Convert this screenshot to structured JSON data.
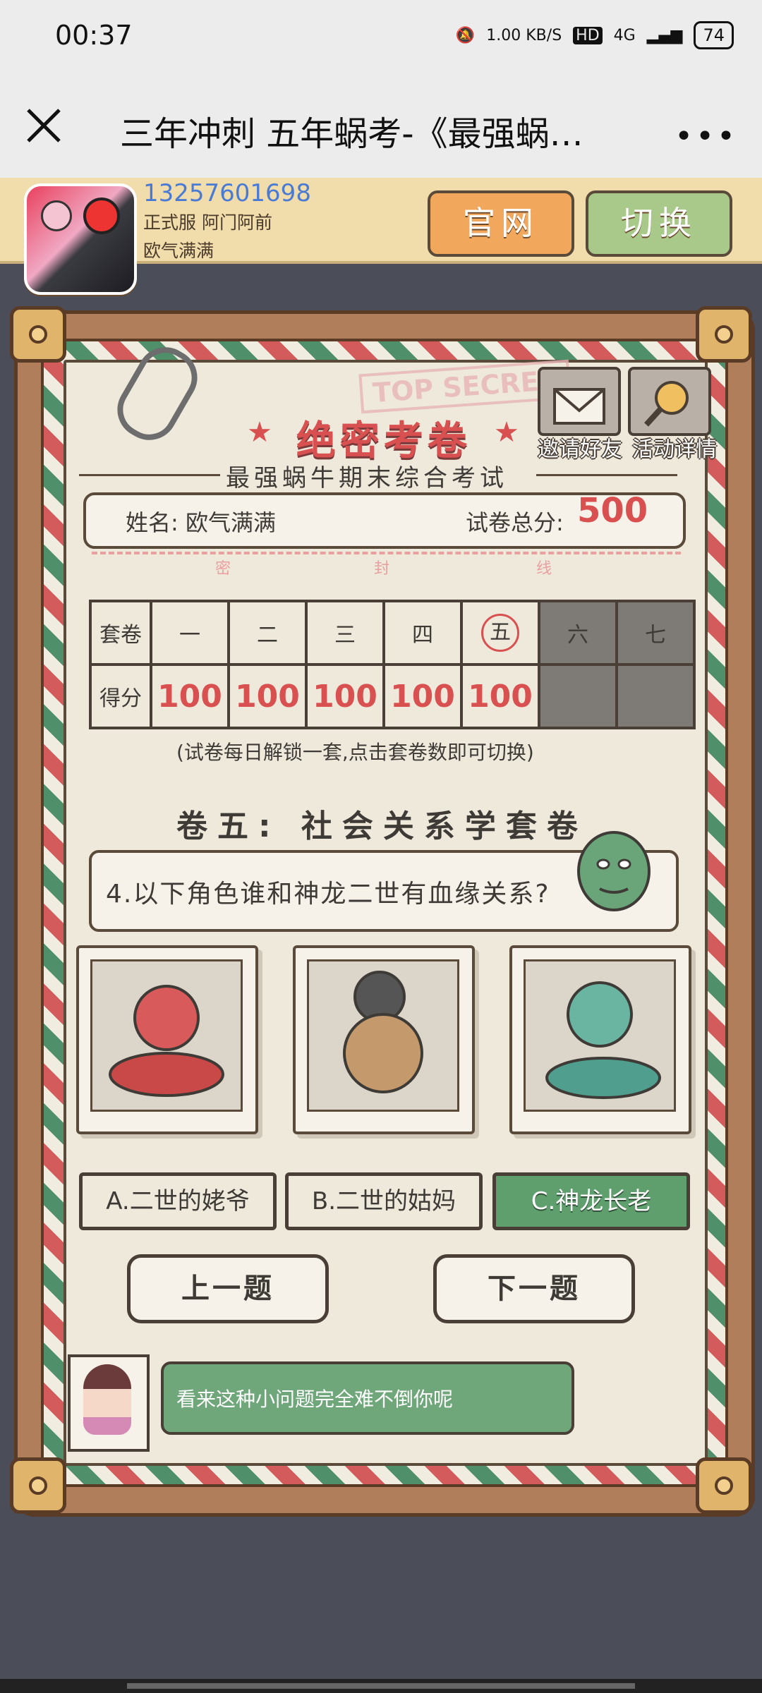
{
  "status_bar": {
    "time": "00:37",
    "net_speed": "1.00 KB/S",
    "hd": "HD",
    "signal": "4G",
    "battery": "74"
  },
  "title_bar": {
    "title": "三年冲刺 五年蜗考-《最强蜗…",
    "more": "•••"
  },
  "user": {
    "phone": "13257601698",
    "server": "正式服 阿门阿前",
    "nickname": "欧气满满"
  },
  "header_buttons": {
    "official": "官网",
    "switch": "切换"
  },
  "paper": {
    "stamp": "TOP SECRET",
    "title": "绝密考卷",
    "subtitle": "最强蜗牛期末综合考试",
    "invite": "邀请好友",
    "activity": "活动详情",
    "name_label": "姓名: 欧气满满",
    "score_label": "试卷总分:",
    "total_score": "500",
    "seal": [
      "密",
      "封",
      "线"
    ]
  },
  "score_table": {
    "set_header": "套卷",
    "score_header": "得分",
    "sets": [
      "一",
      "二",
      "三",
      "四",
      "五",
      "六",
      "七"
    ],
    "scores": [
      "100",
      "100",
      "100",
      "100",
      "100",
      "",
      ""
    ],
    "current_set_index": 4,
    "hint": "(试卷每日解锁一套,点击套卷数即可切换)"
  },
  "question": {
    "set_title": "卷五: 社会关系学套卷",
    "text": "4.以下角色谁和神龙二世有血缘关系?"
  },
  "options": [
    {
      "label": "A.二世的姥爷",
      "selected": false
    },
    {
      "label": "B.二世的姑妈",
      "selected": false
    },
    {
      "label": "C.神龙长老",
      "selected": true
    }
  ],
  "nav": {
    "prev": "上一题",
    "next": "下一题"
  },
  "tip": "看来这种小问题完全难不倒你呢",
  "colors": {
    "accent_red": "#d95050",
    "selected_green": "#5f9f6e",
    "official_btn": "#f2a85c",
    "switch_btn": "#a8c98a"
  }
}
